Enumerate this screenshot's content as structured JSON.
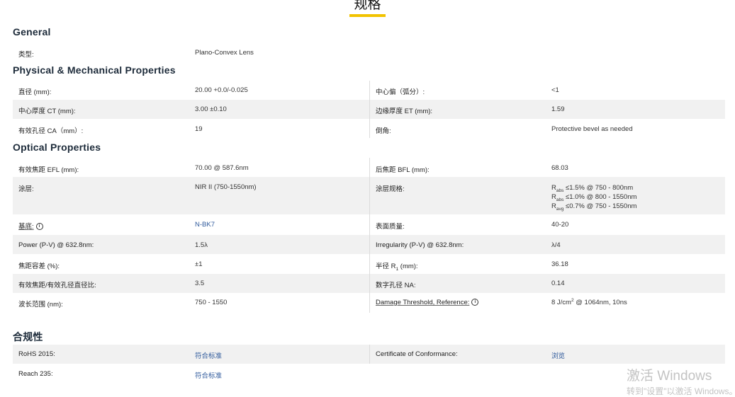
{
  "page_title": "规格",
  "sections": {
    "general": {
      "title": "General",
      "rows": [
        {
          "l1": "类型:",
          "v1": "Plano-Convex Lens"
        }
      ]
    },
    "physical": {
      "title": "Physical & Mechanical Properties",
      "rows": [
        {
          "l1": "直径 (mm):",
          "v1": "20.00 +0.0/-0.025",
          "l2": "中心偏（弧分）:",
          "v2": "<1"
        },
        {
          "l1": "中心厚度 CT (mm):",
          "v1": "3.00 ±0.10",
          "l2": "边缘厚度 ET (mm):",
          "v2": "1.59"
        },
        {
          "l1": "有效孔径 CA（mm）:",
          "v1": "19",
          "l2": "倒角:",
          "v2": "Protective bevel as needed"
        }
      ]
    },
    "optical": {
      "title": "Optical Properties",
      "rows": [
        {
          "l1": "有效焦距 EFL (mm):",
          "v1": "70.00 @ 587.6nm",
          "l2": "后焦距 BFL (mm):",
          "v2": "68.03"
        },
        {
          "l1": "涂层:",
          "v1": "NIR II (750-1550nm)",
          "l2": "涂层规格:",
          "coat": [
            {
              "r": "R",
              "sub": "abs",
              "rest": " ≤1.5% @ 750 - 800nm"
            },
            {
              "r": "R",
              "sub": "abs",
              "rest": " ≤1.0% @ 800 - 1550nm"
            },
            {
              "r": "R",
              "sub": "avg",
              "rest": " ≤0.7% @ 750 - 1550nm"
            }
          ]
        },
        {
          "l1": "基底:",
          "v1": "N-BK7",
          "l2": "表面质量:",
          "v2": "40-20"
        },
        {
          "l1": "Power (P-V) @ 632.8nm:",
          "v1": "1.5λ",
          "l2": "Irregularity (P-V) @ 632.8nm:",
          "v2": "λ/4"
        },
        {
          "l1": "焦距容差 (%):",
          "v1": "±1",
          "l2_pre": "半径 R",
          "l2_sub": "1",
          "l2_post": " (mm):",
          "v2": "36.18"
        },
        {
          "l1": "有效焦距/有效孔径直径比:",
          "v1": "3.5",
          "l2": "数字孔径 NA:",
          "v2": "0.14"
        },
        {
          "l1": "波长范围 (nm):",
          "v1": "750 - 1550",
          "l2": "Damage Threshold, Reference:",
          "v2_pre": "8 J/cm",
          "v2_sup": "2",
          "v2_post": " @ 1064nm, 10ns"
        }
      ]
    },
    "compliance": {
      "title": "合规性",
      "rows": [
        {
          "l1": "RoHS 2015:",
          "v1": "符合标准",
          "l2": "Certificate of Conformance:",
          "v2": "浏览"
        },
        {
          "l1": "Reach 235:",
          "v1": "符合标准"
        }
      ]
    }
  },
  "icons": {
    "info": "info-icon"
  },
  "colors": {
    "accent": "#f2c300",
    "link": "#2f5a9c",
    "row_shade": "#f1f1f1"
  },
  "watermark": {
    "line1": "激活 Windows",
    "line2": "转到\"设置\"以激活 Windows。"
  }
}
